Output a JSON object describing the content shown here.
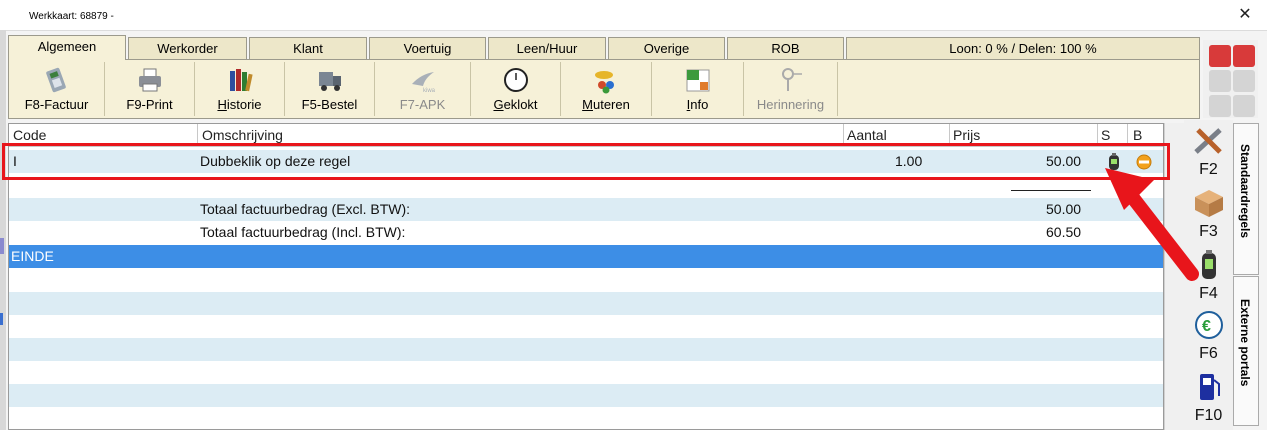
{
  "window": {
    "title": "Werkkaart: 68879 -",
    "close_icon": "close-icon"
  },
  "tabs": [
    {
      "label": "Algemeen",
      "active": true
    },
    {
      "label": "Werkorder"
    },
    {
      "label": "Klant"
    },
    {
      "label": "Voertuig"
    },
    {
      "label": "Leen/Huur"
    },
    {
      "label": "Overige"
    },
    {
      "label": "ROB"
    }
  ],
  "status_text": "Loon: 0 % / Delen: 100 %",
  "toolbar": [
    {
      "label": "F8-Factuur",
      "icon": "payment-terminal-icon",
      "enabled": true
    },
    {
      "label": "F9-Print",
      "icon": "printer-icon",
      "enabled": true
    },
    {
      "label": "Historie",
      "icon": "books-icon",
      "enabled": true
    },
    {
      "label": "F5-Bestel",
      "icon": "truck-icon",
      "enabled": true
    },
    {
      "label": "F7-APK",
      "icon": "apk-logo-icon",
      "enabled": false
    },
    {
      "label": "Geklokt",
      "icon": "clock-icon",
      "enabled": true
    },
    {
      "label": "Muteren",
      "icon": "car-people-icon",
      "enabled": true
    },
    {
      "label": "Info",
      "icon": "calendar-info-icon",
      "enabled": true
    },
    {
      "label": "Herinnering",
      "icon": "pin-icon",
      "enabled": false
    }
  ],
  "grid": {
    "headers": [
      "Code",
      "Omschrijving",
      "Aantal",
      "Prijs",
      "S",
      "B"
    ],
    "rows": [
      {
        "code": "I",
        "description": "Dubbeklik op deze regel",
        "quantity": "1.00",
        "price": "50.00"
      }
    ],
    "totals": [
      {
        "label": "Totaal factuurbedrag (Excl. BTW):",
        "value": "50.00"
      },
      {
        "label": "Totaal factuurbedrag (Incl. BTW):",
        "value": "60.50"
      }
    ],
    "end_label": "EINDE"
  },
  "side_keys": [
    {
      "key": "F2",
      "icon": "tools-icon"
    },
    {
      "key": "F3",
      "icon": "box-icon"
    },
    {
      "key": "F4",
      "icon": "battery-icon"
    },
    {
      "key": "F6",
      "icon": "euro-circle-icon"
    },
    {
      "key": "F10",
      "icon": "fuel-pump-icon"
    }
  ],
  "vertical_tabs": [
    "Standaardregels",
    "Externe portals"
  ],
  "colors": {
    "highlight": "#e8151b",
    "selected_row": "#3d8ee6",
    "alt_row": "#dcecf4",
    "toolbar_bg": "#f6f1d8"
  }
}
